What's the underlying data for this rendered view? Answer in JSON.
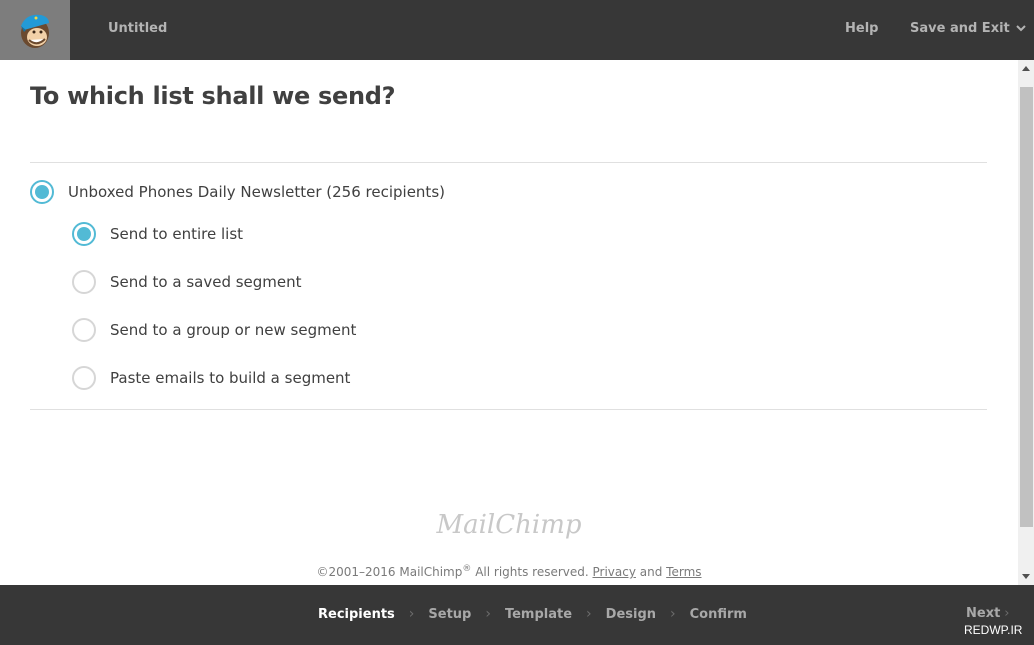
{
  "header": {
    "logo": "mailchimp-freddie-logo",
    "title": "Untitled",
    "help_label": "Help",
    "save_exit_label": "Save and Exit"
  },
  "main": {
    "title": "To which list shall we send?",
    "list_option": {
      "label": "Unboxed Phones Daily Newsletter (256 recipients)",
      "checked": true
    },
    "segment_options": [
      {
        "label": "Send to entire list",
        "checked": true
      },
      {
        "label": "Send to a saved segment",
        "checked": false
      },
      {
        "label": "Send to a group or new segment",
        "checked": false
      },
      {
        "label": "Paste emails to build a segment",
        "checked": false
      }
    ]
  },
  "footer": {
    "brand": "MailChimp",
    "copyright_prefix": "©2001–2016 MailChimp",
    "registered": "®",
    "rights": " All rights reserved. ",
    "privacy_label": "Privacy",
    "and": " and ",
    "terms_label": "Terms"
  },
  "wizard": {
    "steps": [
      {
        "label": "Recipients",
        "active": true
      },
      {
        "label": "Setup",
        "active": false
      },
      {
        "label": "Template",
        "active": false
      },
      {
        "label": "Design",
        "active": false
      },
      {
        "label": "Confirm",
        "active": false
      }
    ],
    "next_label": "Next",
    "watermark": "REDWP.IR"
  },
  "colors": {
    "accent": "#52bad5",
    "bar_bg": "#373737",
    "logo_bg": "#7d7d7d"
  }
}
